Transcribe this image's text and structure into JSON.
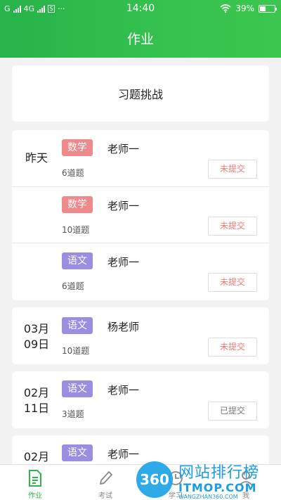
{
  "status_bar": {
    "carrier_left": "G",
    "network": "4G",
    "sim_icon": "sim-icon",
    "dots": "···",
    "time": "14:40",
    "battery": "39%",
    "battery_level": 0.39
  },
  "header": {
    "title": "作业"
  },
  "challenge": {
    "label": "习题挑战"
  },
  "groups": [
    {
      "date": "昨天",
      "items": [
        {
          "subject": "数学",
          "teacher": "老师一",
          "count": "6道题",
          "status": "未提交"
        },
        {
          "subject": "数学",
          "teacher": "老师一",
          "count": "10道题",
          "status": "未提交"
        },
        {
          "subject": "语文",
          "teacher": "老师一",
          "count": "6道题",
          "status": "未提交"
        }
      ]
    },
    {
      "date_line1": "03月",
      "date_line2": "09日",
      "items": [
        {
          "subject": "语文",
          "teacher": "杨老师",
          "count": "10道题",
          "status": "未提交"
        }
      ]
    },
    {
      "date_line1": "02月",
      "date_line2": "11日",
      "items": [
        {
          "subject": "语文",
          "teacher": "老师一",
          "count": "3道题",
          "status": "已提交"
        }
      ]
    },
    {
      "date_line1": "02月",
      "items": [
        {
          "subject": "语文",
          "teacher": "老师一"
        }
      ]
    }
  ],
  "bottom_nav": [
    {
      "label": "作业",
      "icon": "document-icon",
      "active": true
    },
    {
      "label": "考试",
      "icon": "pencil-icon",
      "active": false
    },
    {
      "label": "学习",
      "icon": "clock-icon",
      "active": false
    },
    {
      "label": "我",
      "icon": "user-icon",
      "active": false
    }
  ],
  "watermark": {
    "logo": "360",
    "line1": "网站排行榜",
    "line2": "ITMOP.COM",
    "line3": "WANGZHAN360.COM"
  },
  "colors": {
    "primary": "#2fb64b",
    "math_badge": "#f0898b",
    "chinese_badge": "#9b8ee0",
    "pending": "#e87b7b"
  }
}
